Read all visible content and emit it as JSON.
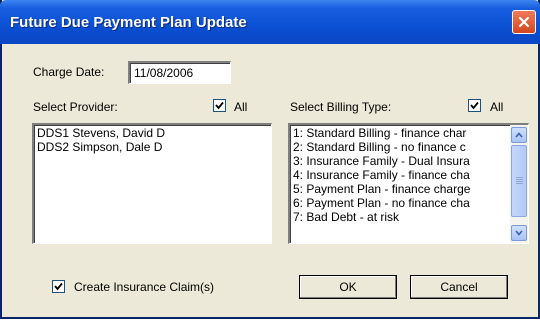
{
  "window": {
    "title": "Future Due Payment Plan Update",
    "close_icon": "close-icon"
  },
  "charge_date": {
    "label": "Charge Date:",
    "value": "11/08/2006"
  },
  "provider": {
    "label": "Select Provider:",
    "all_label": "All",
    "all_checked": true,
    "items": [
      "DDS1 Stevens, David D",
      "DDS2 Simpson, Dale D"
    ]
  },
  "billing_type": {
    "label": "Select Billing Type:",
    "all_label": "All",
    "all_checked": true,
    "items": [
      "1: Standard Billing - finance char",
      "2: Standard Billing - no finance c",
      "3: Insurance Family - Dual Insura",
      "4: Insurance Family - finance cha",
      "5: Payment Plan - finance charge",
      "6: Payment Plan - no finance cha",
      "7: Bad Debt - at risk"
    ]
  },
  "create_claims": {
    "label": "Create Insurance Claim(s)",
    "checked": true
  },
  "buttons": {
    "ok": "OK",
    "cancel": "Cancel"
  },
  "colors": {
    "title_bar": "#0b4fd4",
    "dialog_bg": "#ece9d8",
    "close_button": "#d5451f"
  }
}
